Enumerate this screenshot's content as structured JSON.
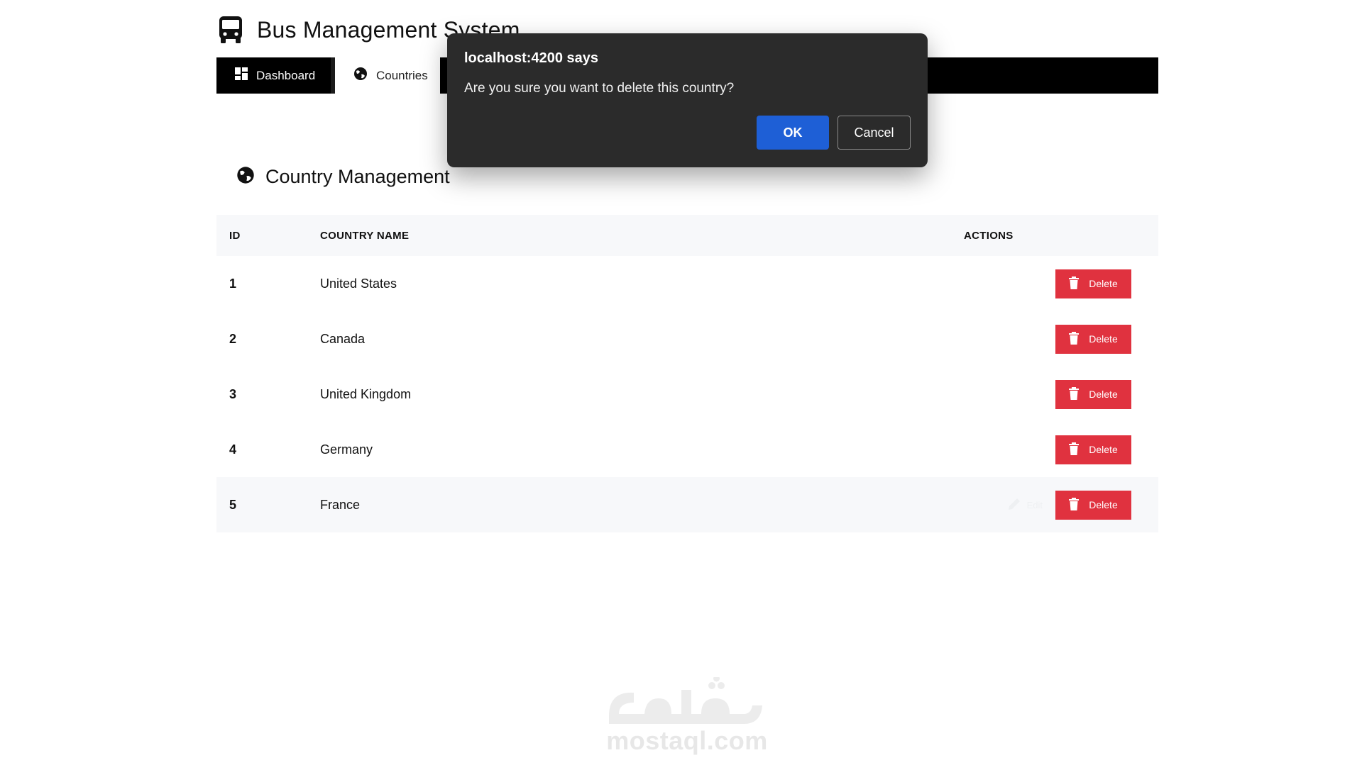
{
  "app": {
    "title": "Bus Management System"
  },
  "nav": {
    "items": [
      {
        "label": "Dashboard",
        "icon": "dashboard-icon",
        "active": true
      },
      {
        "label": "Countries",
        "icon": "globe-icon",
        "active": false
      }
    ]
  },
  "section": {
    "title": "Country Management",
    "icon": "globe-icon"
  },
  "table": {
    "headers": {
      "id": "ID",
      "name": "COUNTRY NAME",
      "actions": "ACTIONS"
    },
    "rows": [
      {
        "id": "1",
        "name": "United States",
        "delete_label": "Delete"
      },
      {
        "id": "2",
        "name": "Canada",
        "delete_label": "Delete"
      },
      {
        "id": "3",
        "name": "United Kingdom",
        "delete_label": "Delete"
      },
      {
        "id": "4",
        "name": "Germany",
        "delete_label": "Delete"
      },
      {
        "id": "5",
        "name": "France",
        "delete_label": "Delete",
        "edit_label": "Edit"
      }
    ]
  },
  "dialog": {
    "title": "localhost:4200 says",
    "message": "Are you sure you want to delete this country?",
    "ok_label": "OK",
    "cancel_label": "Cancel"
  },
  "watermark": {
    "text": "mostaql.com"
  },
  "colors": {
    "delete": "#e0323f",
    "ok": "#1e5fd6",
    "dialog_bg": "#2b2b2b",
    "nav_bg": "#000000"
  }
}
